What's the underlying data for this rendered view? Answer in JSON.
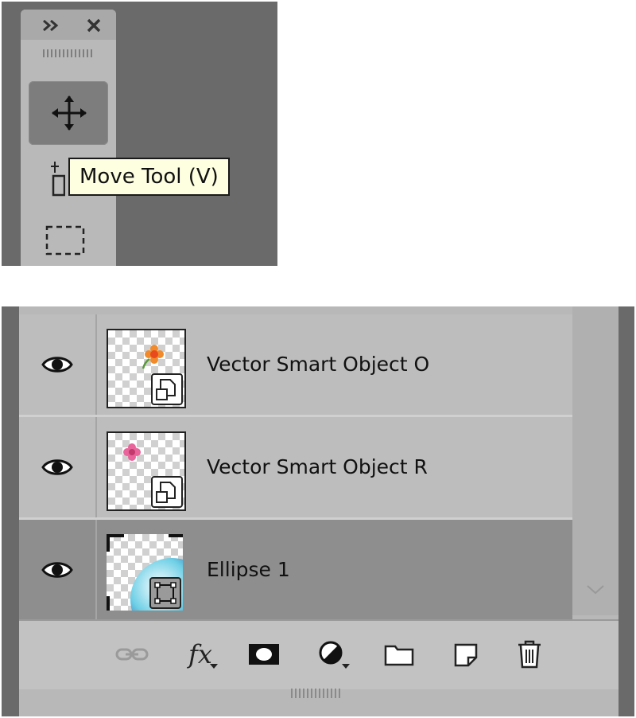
{
  "toolbar": {
    "tooltip_text": "Move Tool (V)",
    "tools": [
      {
        "name": "move-icon",
        "selected": true
      },
      {
        "name": "artboard-icon",
        "selected": false
      },
      {
        "name": "rectangular-marquee-icon",
        "selected": false
      }
    ],
    "header_icons": [
      "collapse-icon",
      "close-icon"
    ]
  },
  "layers": {
    "rows": [
      {
        "name": "Vector Smart Object O",
        "visible": true,
        "selected": false,
        "type": "smart-object"
      },
      {
        "name": "Vector Smart Object R",
        "visible": true,
        "selected": false,
        "type": "smart-object"
      },
      {
        "name": "Ellipse 1",
        "visible": true,
        "selected": true,
        "type": "shape"
      }
    ],
    "footer_buttons": [
      "link-icon",
      "fx-icon",
      "mask-icon",
      "adjustment-icon",
      "folder-icon",
      "new-layer-icon",
      "trash-icon"
    ],
    "fx_label": "fx"
  },
  "colors": {
    "panel_bg": "#bdbdbd",
    "selected_row": "#8e8e8e",
    "tooltip_bg": "#fefee0",
    "workspace_bg": "#6a6a6a"
  }
}
